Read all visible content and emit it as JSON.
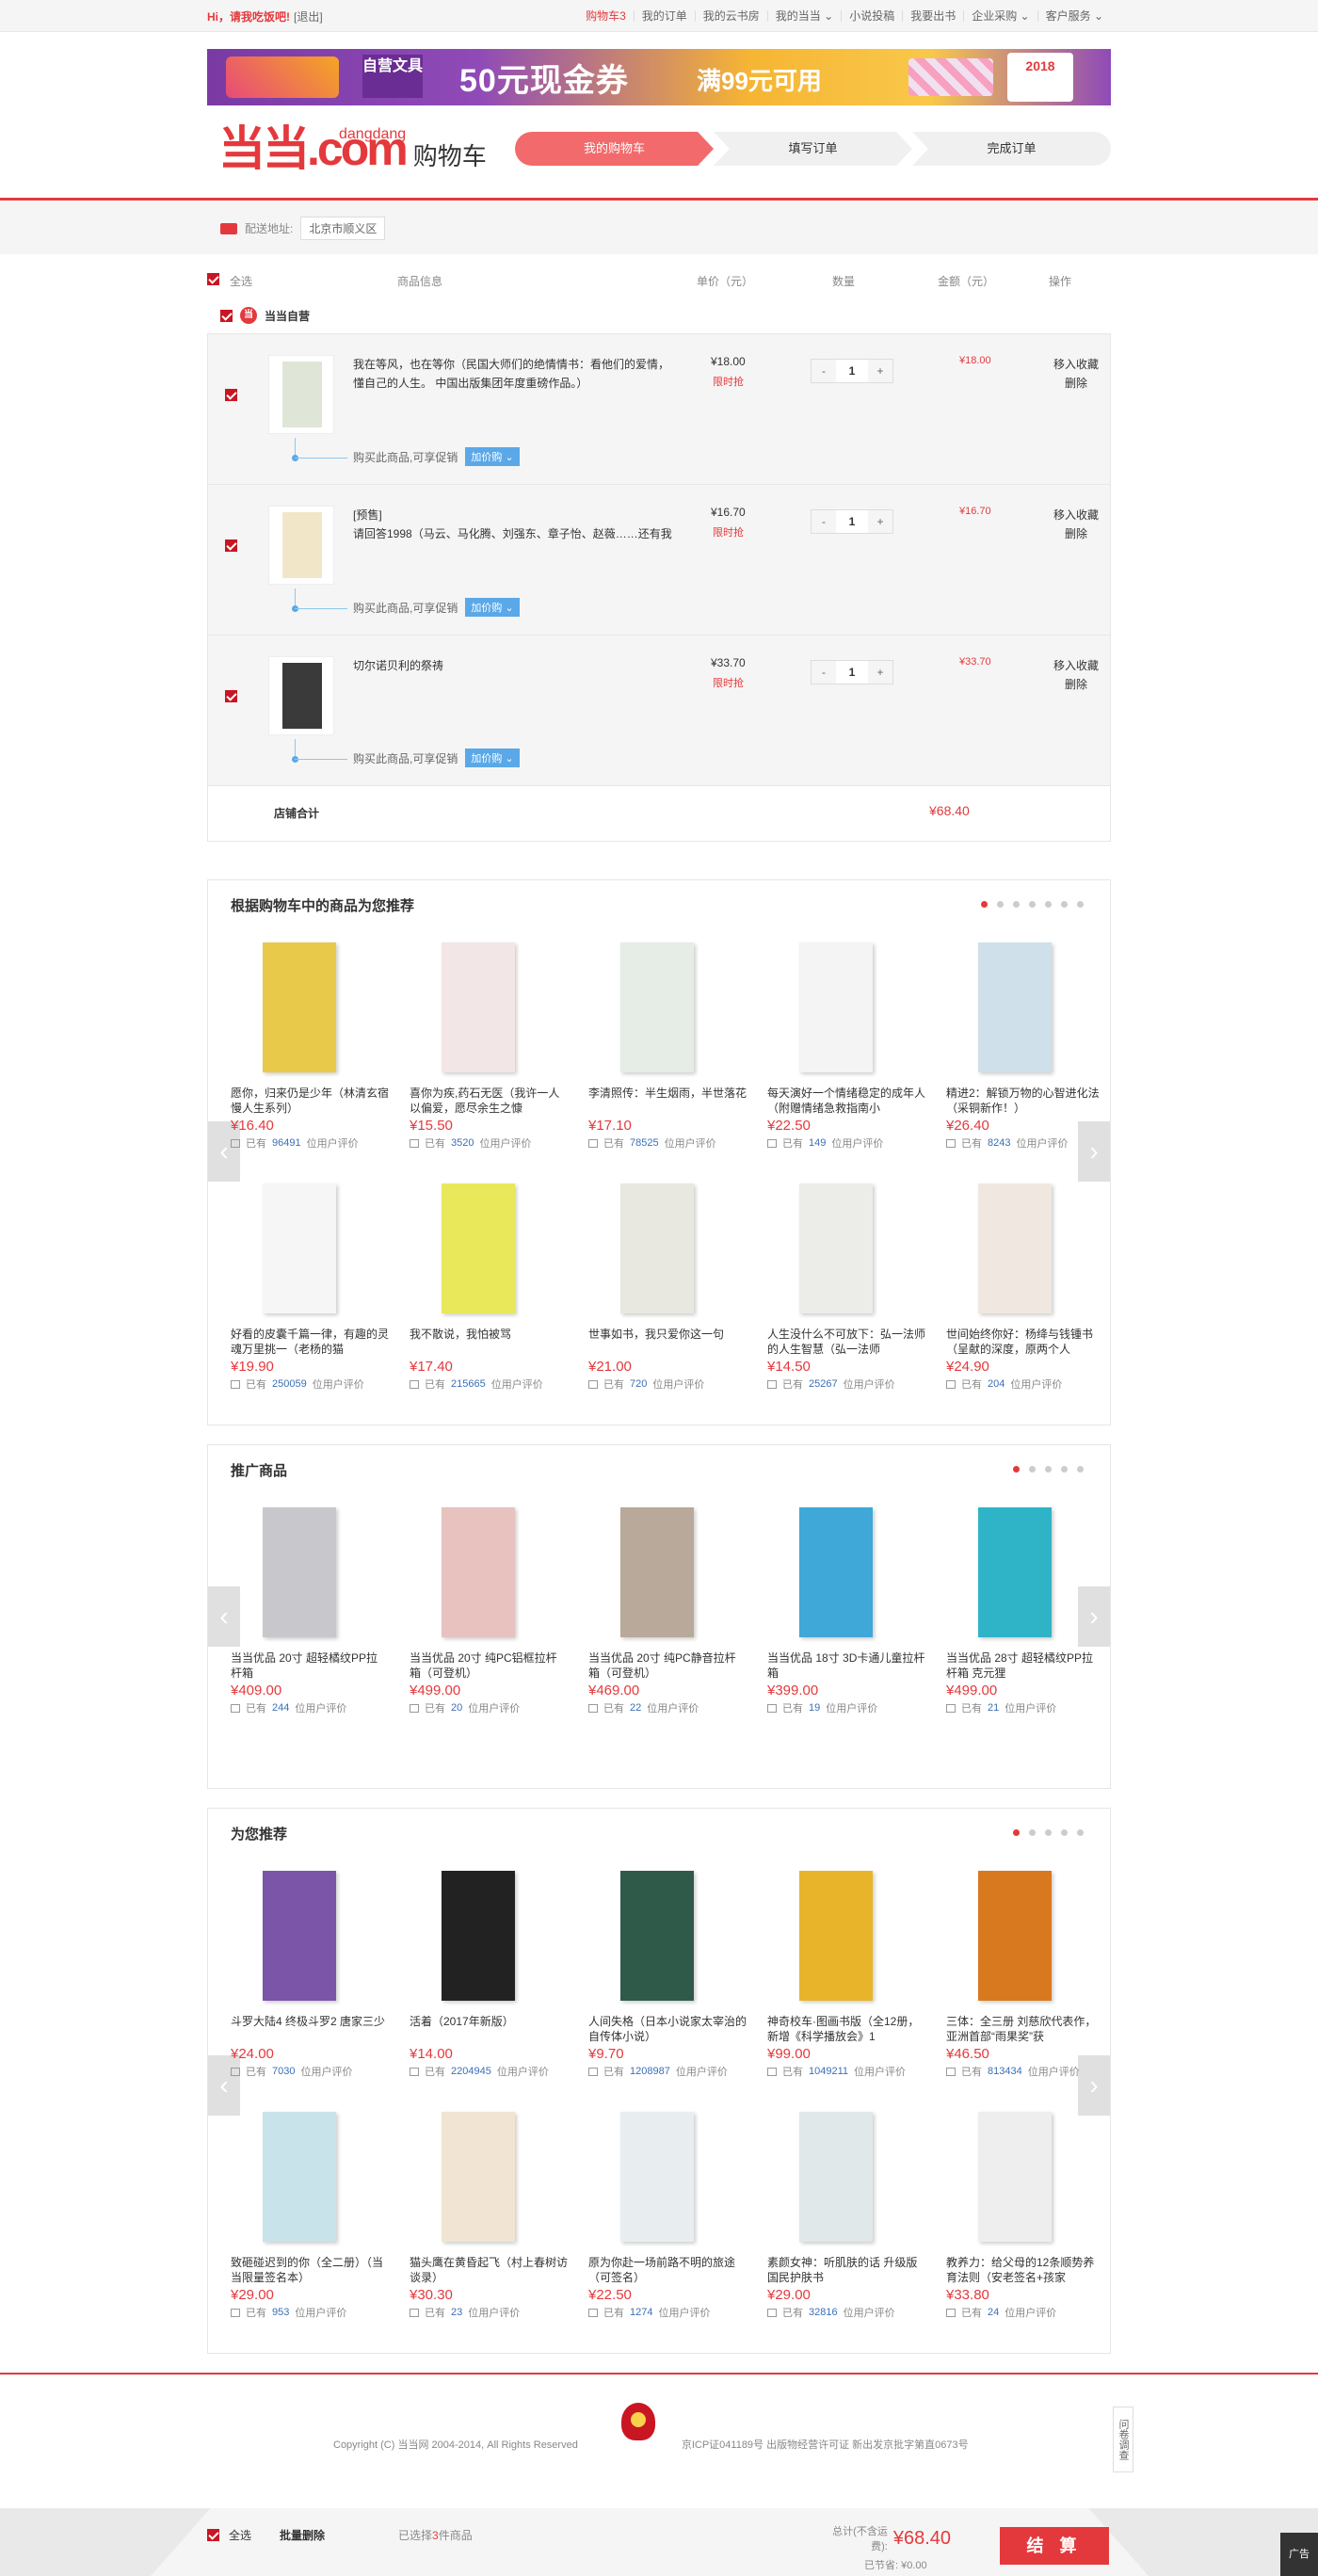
{
  "topbar": {
    "greeting_hi": "Hi，请我吃饭吧!",
    "logout": "[退出]",
    "links": [
      "购物车3",
      "我的订单",
      "我的云书房",
      "我的当当 ⌄",
      "小说投稿",
      "我要出书",
      "企业采购 ⌄",
      "客户服务 ⌄"
    ]
  },
  "banner": {
    "tag": "自营文具",
    "amount": "50元现金券",
    "cond": "满99元可用",
    "year": "2018"
  },
  "header": {
    "logo_dd": "当当",
    "logo_domain": "dangdang",
    "logo_com": ".com",
    "cart_title": "购物车"
  },
  "steps": [
    "我的购物车",
    "填写订单",
    "完成订单"
  ],
  "address": {
    "label": "配送地址:",
    "value": "北京市顺义区"
  },
  "table_head": {
    "select_all": "全选",
    "info": "商品信息",
    "price": "单价（元）",
    "qty": "数量",
    "amount": "金额（元）",
    "op": "操作"
  },
  "shop": {
    "name": "当当自营"
  },
  "items": [
    {
      "title": "我在等风，也在等你（民国大师们的绝情情书：看他们的爱情，懂自己的人生。 中国出版集团年度重磅作品。）",
      "price": "¥18.00",
      "badge": "限时抢",
      "qty": "1",
      "amount": "¥18.00",
      "op1": "移入收藏",
      "op2": "删除",
      "promo": "购买此商品,可享促销",
      "promo_btn": "加价购 ⌄",
      "cover": "#dfe6d8"
    },
    {
      "title": "[预售]\n请回答1998（马云、马化腾、刘强东、章子怡、赵薇……还有我",
      "price": "¥16.70",
      "badge": "限时抢",
      "qty": "1",
      "amount": "¥16.70",
      "op1": "移入收藏",
      "op2": "删除",
      "promo": "购买此商品,可享促销",
      "promo_btn": "加价购 ⌄",
      "cover": "#f1e7c8"
    },
    {
      "title": "切尔诺贝利的祭祷",
      "price": "¥33.70",
      "badge": "限时抢",
      "qty": "1",
      "amount": "¥33.70",
      "op1": "移入收藏",
      "op2": "删除",
      "promo": "购买此商品,可享促销",
      "promo_btn": "加价购 ⌄",
      "cover": "#3a3a3a"
    }
  ],
  "subtotal": {
    "label": "店铺合计",
    "value": "¥68.40"
  },
  "rec1": {
    "title": "根据购物车中的商品为您推荐",
    "products": [
      {
        "name": "愿你，归来仍是少年（林清玄宿慢人生系列）",
        "price": "¥16.40",
        "pre": "已有",
        "count": "96491",
        "post": "位用户评价",
        "color": "#e9c94a"
      },
      {
        "name": "喜你为疾,药石无医（我许一人以偏爱，愿尽余生之慷",
        "price": "¥15.50",
        "pre": "已有",
        "count": "3520",
        "post": "位用户评价",
        "color": "#f3e6e6"
      },
      {
        "name": "李清照传：半生烟雨，半世落花",
        "price": "¥17.10",
        "pre": "已有",
        "count": "78525",
        "post": "位用户评价",
        "color": "#e6ece6"
      },
      {
        "name": "每天演好一个情绪稳定的成年人（附赠情绪急救指南小",
        "price": "¥22.50",
        "pre": "已有",
        "count": "149",
        "post": "位用户评价",
        "color": "#f4f4f4"
      },
      {
        "name": "精进2：解锁万物的心智进化法（采铜新作！）",
        "price": "¥26.40",
        "pre": "已有",
        "count": "8243",
        "post": "位用户评价",
        "color": "#cfe0ea"
      },
      {
        "name": "好看的皮囊千篇一律，有趣的灵魂万里挑一（老杨的猫",
        "price": "¥19.90",
        "pre": "已有",
        "count": "250059",
        "post": "位用户评价",
        "color": "#f6f6f6"
      },
      {
        "name": "我不散说，我怕被骂",
        "price": "¥17.40",
        "pre": "已有",
        "count": "215665",
        "post": "位用户评价",
        "color": "#e8e85a"
      },
      {
        "name": "世事如书，我只爱你这一句",
        "price": "¥21.00",
        "pre": "已有",
        "count": "720",
        "post": "位用户评价",
        "color": "#e8e8e0"
      },
      {
        "name": "人生没什么不可放下：弘一法师的人生智慧（弘一法师",
        "price": "¥14.50",
        "pre": "已有",
        "count": "25267",
        "post": "位用户评价",
        "color": "#ecece8"
      },
      {
        "name": "世间始终你好：杨绛与钱锺书（呈献的深度，原两个人",
        "price": "¥24.90",
        "pre": "已有",
        "count": "204",
        "post": "位用户评价",
        "color": "#f0e8e0"
      }
    ]
  },
  "rec2": {
    "title": "推广商品",
    "products": [
      {
        "name": "当当优品 20寸 超轻橘纹PP拉杆箱",
        "price": "¥409.00",
        "pre": "已有",
        "count": "244",
        "post": "位用户评价",
        "color": "#c7c7cc"
      },
      {
        "name": "当当优品 20寸 纯PC铝框拉杆箱（可登机）",
        "price": "¥499.00",
        "pre": "已有",
        "count": "20",
        "post": "位用户评价",
        "color": "#e7c2bf"
      },
      {
        "name": "当当优品 20寸 纯PC静音拉杆箱（可登机）",
        "price": "¥469.00",
        "pre": "已有",
        "count": "22",
        "post": "位用户评价",
        "color": "#b9a99a"
      },
      {
        "name": "当当优品 18寸 3D卡通儿童拉杆箱",
        "price": "¥399.00",
        "pre": "已有",
        "count": "19",
        "post": "位用户评价",
        "color": "#3fa8d8"
      },
      {
        "name": "当当优品 28寸 超轻橘纹PP拉杆箱 克元狸",
        "price": "¥499.00",
        "pre": "已有",
        "count": "21",
        "post": "位用户评价",
        "color": "#2fb3c7"
      }
    ]
  },
  "rec3": {
    "title": "为您推荐",
    "products": [
      {
        "name": "斗罗大陆4 终极斗罗2 唐家三少",
        "price": "¥24.00",
        "pre": "已有",
        "count": "7030",
        "post": "位用户评价",
        "color": "#7b55a8"
      },
      {
        "name": "活着（2017年新版）",
        "price": "¥14.00",
        "pre": "已有",
        "count": "2204945",
        "post": "位用户评价",
        "color": "#222222"
      },
      {
        "name": "人间失格（日本小说家太宰治的自传体小说）",
        "price": "¥9.70",
        "pre": "已有",
        "count": "1208987",
        "post": "位用户评价",
        "color": "#2f5a4a"
      },
      {
        "name": "神奇校车·图画书版（全12册，新增《科学播放会》1",
        "price": "¥99.00",
        "pre": "已有",
        "count": "1049211",
        "post": "位用户评价",
        "color": "#e8b52a"
      },
      {
        "name": "三体：全三册 刘慈欣代表作，亚洲首部“雨果奖”获",
        "price": "¥46.50",
        "pre": "已有",
        "count": "813434",
        "post": "位用户评价",
        "color": "#d8791f"
      },
      {
        "name": "致砸碰迟到的你（全二册）（当当限量签名本）",
        "price": "¥29.00",
        "pre": "已有",
        "count": "953",
        "post": "位用户评价",
        "color": "#c9e3ea"
      },
      {
        "name": "猫头鹰在黄昏起飞（村上春树访谈录）",
        "price": "¥30.30",
        "pre": "已有",
        "count": "23",
        "post": "位用户评价",
        "color": "#f2e4d2"
      },
      {
        "name": "原为你赴一场前路不明的旅途（可签名）",
        "price": "¥22.50",
        "pre": "已有",
        "count": "1274",
        "post": "位用户评价",
        "color": "#e8eef0"
      },
      {
        "name": "素颜女神：听肌肤的话 升级版 国民护肤书",
        "price": "¥29.00",
        "pre": "已有",
        "count": "32816",
        "post": "位用户评价",
        "color": "#e0e8ea"
      },
      {
        "name": "教养力：给父母的12条顺势养育法则（安老签名+孩家",
        "price": "¥33.80",
        "pre": "已有",
        "count": "24",
        "post": "位用户评价",
        "color": "#eeeeee"
      }
    ]
  },
  "footer": {
    "copyright": "Copyright (C) 当当网 2004-2014, All Rights Reserved",
    "icp": "京ICP证041189号 出版物经营许可证 新出发京批字第直0673号",
    "feedback": "问卷调查"
  },
  "bottom": {
    "select_all": "全选",
    "batch_delete": "批量删除",
    "sel_pre": "已选择",
    "sel_count": "3",
    "sel_post": "件商品",
    "total_label": "总计(不含运费):",
    "total": "¥68.40",
    "saved_label": "已节省:",
    "saved": "¥0.00",
    "settle": "结 算",
    "ad": "广告"
  },
  "colors": {
    "accent": "#e4393c",
    "link": "#3a6fb6",
    "promo": "#5aa8e8"
  }
}
